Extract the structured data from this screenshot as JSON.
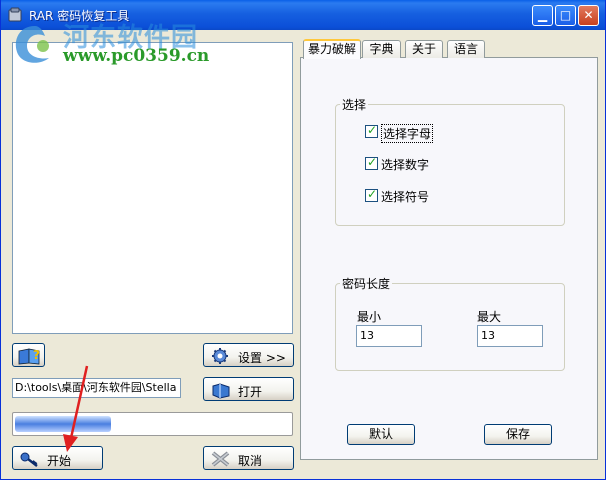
{
  "window": {
    "title": "RAR 密码恢复工具",
    "minimize": "▁",
    "maximize": "□",
    "close": "✕"
  },
  "watermark": {
    "site_name": "河东软件园",
    "url": "www.pc0359.cn"
  },
  "left": {
    "help_icon": "book-help-icon",
    "settings_label": "设置 >>",
    "path_value": "D:\\tools\\桌面\\河东软件园\\Stella",
    "open_label": "打开",
    "progress_fraction": 0.35,
    "start_label": "开始",
    "cancel_label": "取消"
  },
  "tabs": [
    {
      "label": "暴力破解",
      "active": true
    },
    {
      "label": "字典",
      "active": false
    },
    {
      "label": "关于",
      "active": false
    },
    {
      "label": "语言",
      "active": false
    }
  ],
  "select_group": {
    "title": "选择",
    "options": [
      {
        "label": "选择字母",
        "checked": true
      },
      {
        "label": "选择数字",
        "checked": true
      },
      {
        "label": "选择符号",
        "checked": true
      }
    ]
  },
  "length_group": {
    "title": "密码长度",
    "min_label": "最小",
    "min_value": "13",
    "max_label": "最大",
    "max_value": "13"
  },
  "buttons": {
    "default_label": "默认",
    "save_label": "保存"
  },
  "colors": {
    "titlebar": "#0b4fd8",
    "window_bg": "#ece9d8",
    "active_tab_accent": "#ffc83c",
    "annotation_arrow": "#e02020"
  }
}
